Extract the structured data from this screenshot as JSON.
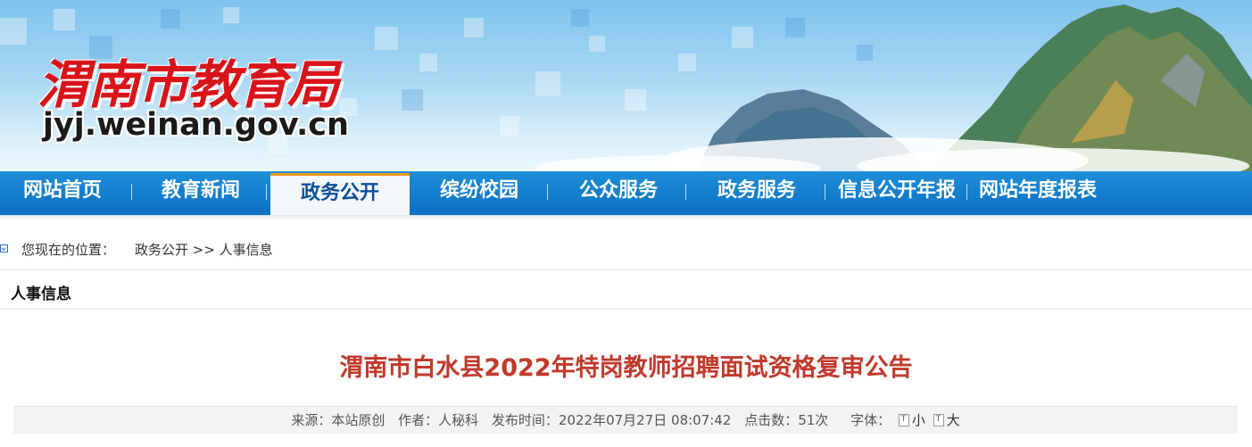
{
  "header": {
    "logo_text": "渭南市教育局",
    "domain": "jyj.weinan.gov.cn"
  },
  "nav": {
    "items": [
      {
        "label": "网站首页"
      },
      {
        "label": "教育新闻"
      },
      {
        "label": "政务公开"
      },
      {
        "label": "缤纷校园"
      },
      {
        "label": "公众服务"
      },
      {
        "label": "政务服务"
      },
      {
        "label": "信息公开年报"
      },
      {
        "label": "网站年度报表"
      }
    ],
    "active": "政务公开"
  },
  "breadcrumb": {
    "prefix": "您现在的位置：",
    "path": "政务公开 >> 人事信息"
  },
  "section": {
    "title": "人事信息"
  },
  "article": {
    "title": "渭南市白水县2022年特岗教师招聘面试资格复审公告",
    "source": "来源：本站原创",
    "author": "作者：人秘科",
    "published": "发布时间：2022年07月27日 08:07:42",
    "clicks": "点击数：51次",
    "font_label": "字体：",
    "font_small": "小",
    "font_large": "大"
  },
  "colors": {
    "nav_bg": "#0b6fc3",
    "title_red": "#c0392b",
    "logo_red": "#d8141a",
    "active_accent": "#f39a1e"
  }
}
